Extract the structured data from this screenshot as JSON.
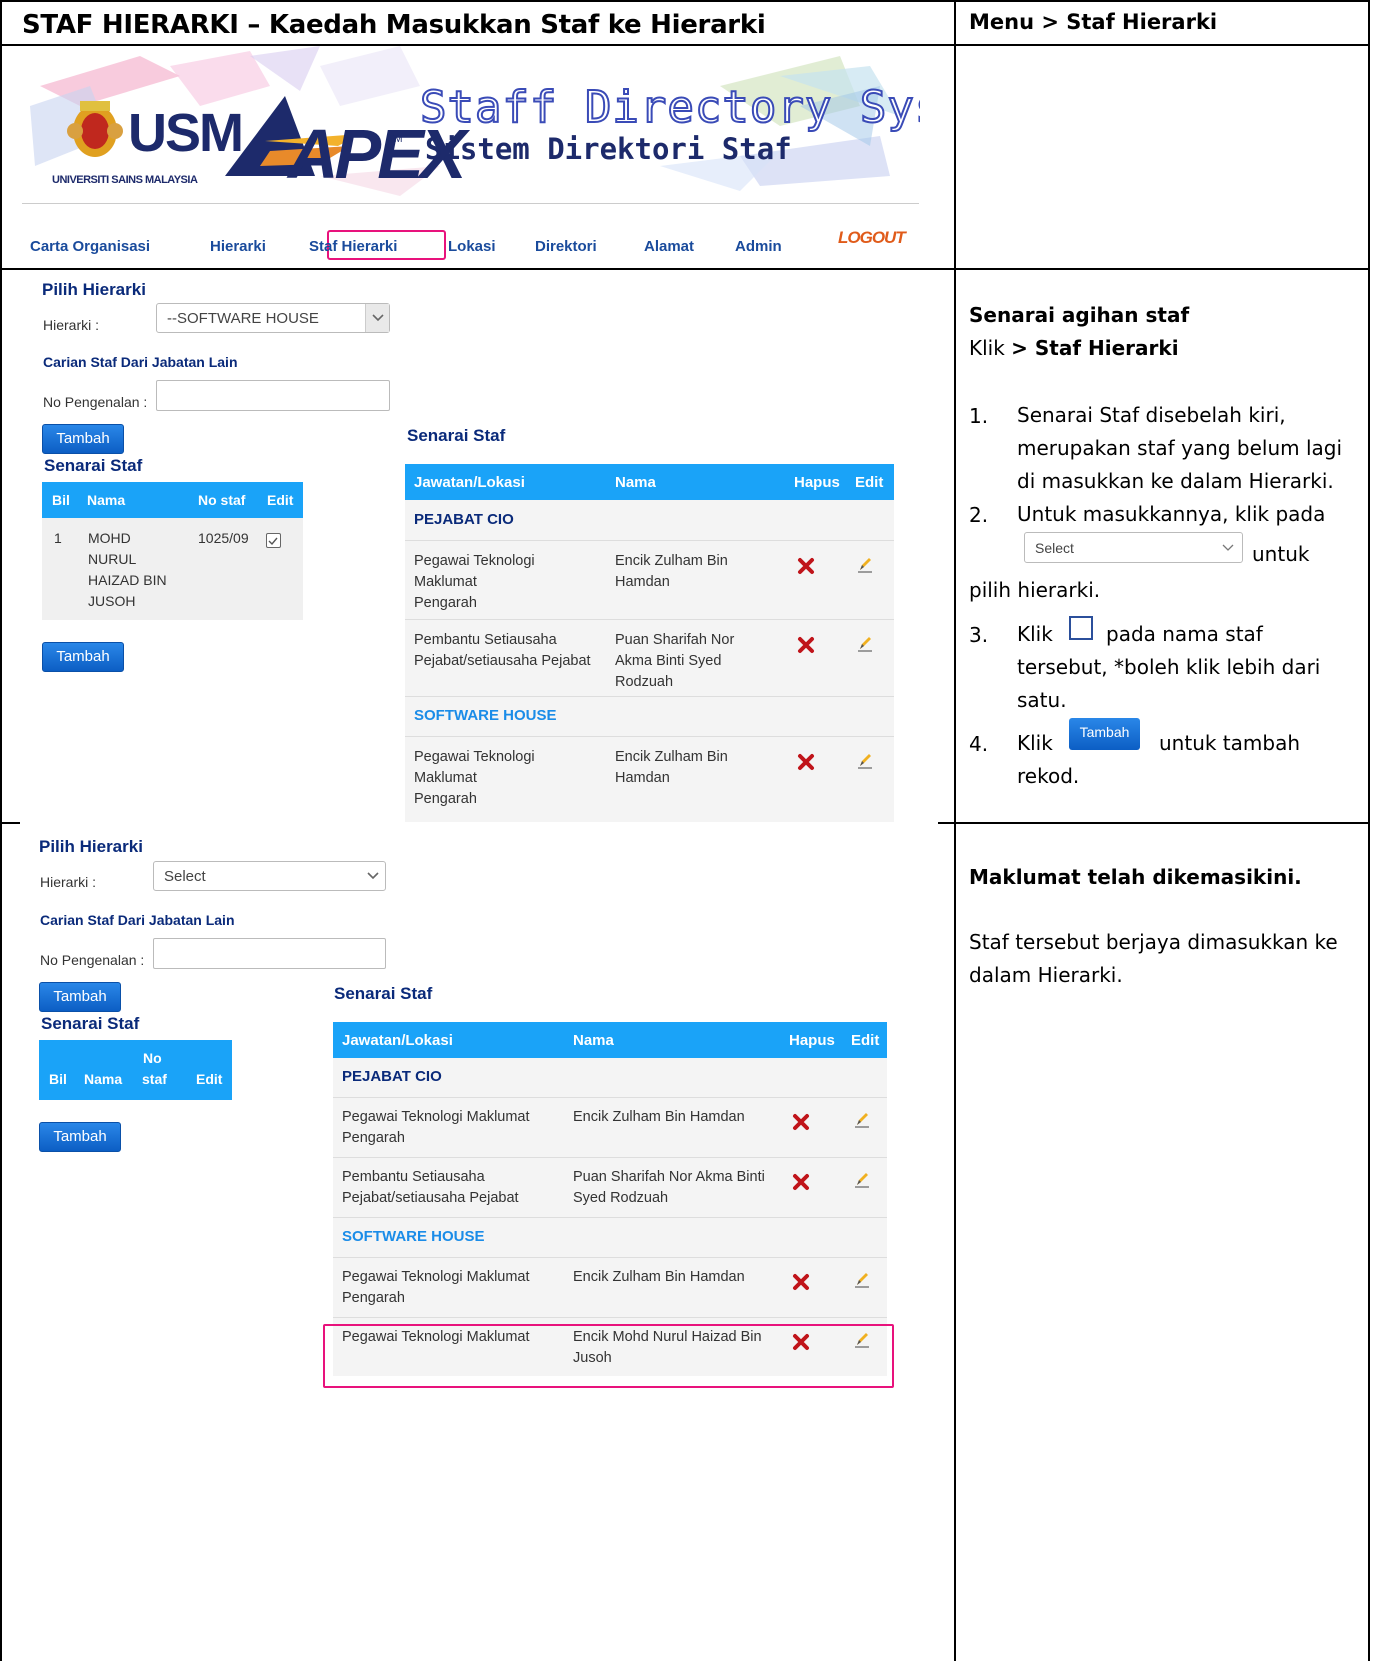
{
  "document": {
    "title": "STAF HIERARKI – Kaedah Masukkan Staf ke Hierarki",
    "menu_path": "Menu > Staf Hierarki"
  },
  "banner": {
    "usm_wordmark": "USM",
    "usm_subtitle": "UNIVERSITI SAINS MALAYSIA",
    "apex_wordmark": "APEX",
    "apex_tm": "TM",
    "system_title": "Staff Directory System",
    "system_subtitle": "Sistem Direktori Staf",
    "logout": "LOGOUT"
  },
  "nav": {
    "items": [
      "Carta Organisasi",
      "Hierarki",
      "Staf Hierarki",
      "Lokasi",
      "Direktori",
      "Alamat",
      "Admin"
    ]
  },
  "panel1": {
    "pilih_heading": "Pilih Hierarki",
    "hierarki_label": "Hierarki :",
    "hierarki_value": "--SOFTWARE HOUSE",
    "carian_heading": "Carian Staf Dari Jabatan Lain",
    "no_pengenalan_label": "No Pengenalan :",
    "no_pengenalan_value": "",
    "tambah_label": "Tambah",
    "senarai_heading": "Senarai Staf",
    "mini_headers": {
      "bil": "Bil",
      "nama": "Nama",
      "no_staf": "No staf",
      "edit": "Edit"
    },
    "mini_rows": [
      {
        "bil": "1",
        "nama": [
          "MOHD",
          "NURUL",
          "HAIZAD BIN",
          "JUSOH"
        ],
        "no_staf": "1025/09",
        "checked": true
      }
    ],
    "tambah2_label": "Tambah",
    "list_heading": "Senarai Staf",
    "list_headers": {
      "jawatan": "Jawatan/Lokasi",
      "nama": "Nama",
      "hapus": "Hapus",
      "edit": "Edit"
    },
    "groups": [
      {
        "name": "PEJABAT CIO",
        "rows": [
          {
            "jawatan": [
              "Pegawai Teknologi",
              "Maklumat",
              "Pengarah"
            ],
            "nama": [
              "Encik Zulham Bin",
              "Hamdan"
            ]
          },
          {
            "jawatan": [
              "Pembantu Setiausaha",
              "Pejabat/setiausaha Pejabat"
            ],
            "nama": [
              "Puan Sharifah Nor",
              "Akma Binti Syed",
              "Rodzuah"
            ]
          }
        ]
      },
      {
        "name": "SOFTWARE HOUSE",
        "rows": [
          {
            "jawatan": [
              "Pegawai Teknologi",
              "Maklumat",
              "Pengarah"
            ],
            "nama": [
              "Encik Zulham Bin",
              "Hamdan"
            ]
          }
        ]
      }
    ]
  },
  "panel2": {
    "pilih_heading": "Pilih Hierarki",
    "hierarki_label": "Hierarki :",
    "hierarki_value": "Select",
    "carian_heading": "Carian Staf Dari Jabatan Lain",
    "no_pengenalan_label": "No Pengenalan :",
    "no_pengenalan_value": "",
    "tambah_label": "Tambah",
    "senarai_heading": "Senarai Staf",
    "mini_headers": {
      "bil": "Bil",
      "nama": "Nama",
      "no": "No",
      "staf": "staf",
      "edit": "Edit"
    },
    "tambah2_label": "Tambah",
    "list_heading": "Senarai Staf",
    "list_headers": {
      "jawatan": "Jawatan/Lokasi",
      "nama": "Nama",
      "hapus": "Hapus",
      "edit": "Edit"
    },
    "groups": [
      {
        "name": "PEJABAT CIO",
        "rows": [
          {
            "jawatan": [
              "Pegawai Teknologi Maklumat",
              "Pengarah"
            ],
            "nama": [
              "Encik Zulham Bin Hamdan"
            ]
          },
          {
            "jawatan": [
              "Pembantu Setiausaha",
              "Pejabat/setiausaha Pejabat"
            ],
            "nama": [
              "Puan Sharifah Nor Akma Binti",
              "Syed Rodzuah"
            ]
          }
        ]
      },
      {
        "name": "SOFTWARE HOUSE",
        "rows": [
          {
            "jawatan": [
              "Pegawai Teknologi Maklumat",
              "Pengarah"
            ],
            "nama": [
              "Encik Zulham Bin Hamdan"
            ]
          },
          {
            "jawatan": [
              "Pegawai Teknologi Maklumat"
            ],
            "nama": [
              "Encik Mohd Nurul Haizad Bin",
              "Jusoh"
            ],
            "highlighted": true
          }
        ]
      }
    ]
  },
  "instructions1": {
    "heading": "Senarai agihan staf",
    "klik": "Klik ",
    "klik_bold": "> Staf Hierarki",
    "steps": [
      {
        "n": "1.",
        "lines": [
          "Senarai  Staf  disebelah  kiri,",
          "merupakan staf yang belum lagi",
          "di masukkan ke dalam Hierarki."
        ]
      },
      {
        "n": "2.",
        "lines": [
          "Untuk masukkannya, klik pada"
        ],
        "select_text": "Select",
        "after_select": "untuk",
        "after_line": "pilih hierarki."
      },
      {
        "n": "3.",
        "pre": "Klik",
        "post": "pada nama staf",
        "lines": [
          "tersebut, *boleh klik lebih dari",
          "satu."
        ]
      },
      {
        "n": "4.",
        "pre": "Klik",
        "button": "Tambah",
        "post": "untuk tambah",
        "lines": [
          "rekod."
        ]
      }
    ]
  },
  "instructions2": {
    "heading": "Maklumat telah dikemasikini.",
    "lines": [
      "Staf tersebut berjaya dimasukkan ke",
      "dalam Hierarki."
    ]
  },
  "colors": {
    "accent_blue": "#1aa3f8",
    "heading_navy": "#0a2a7a",
    "highlight_pink": "#e8127c",
    "delete_red": "#c0141a"
  }
}
